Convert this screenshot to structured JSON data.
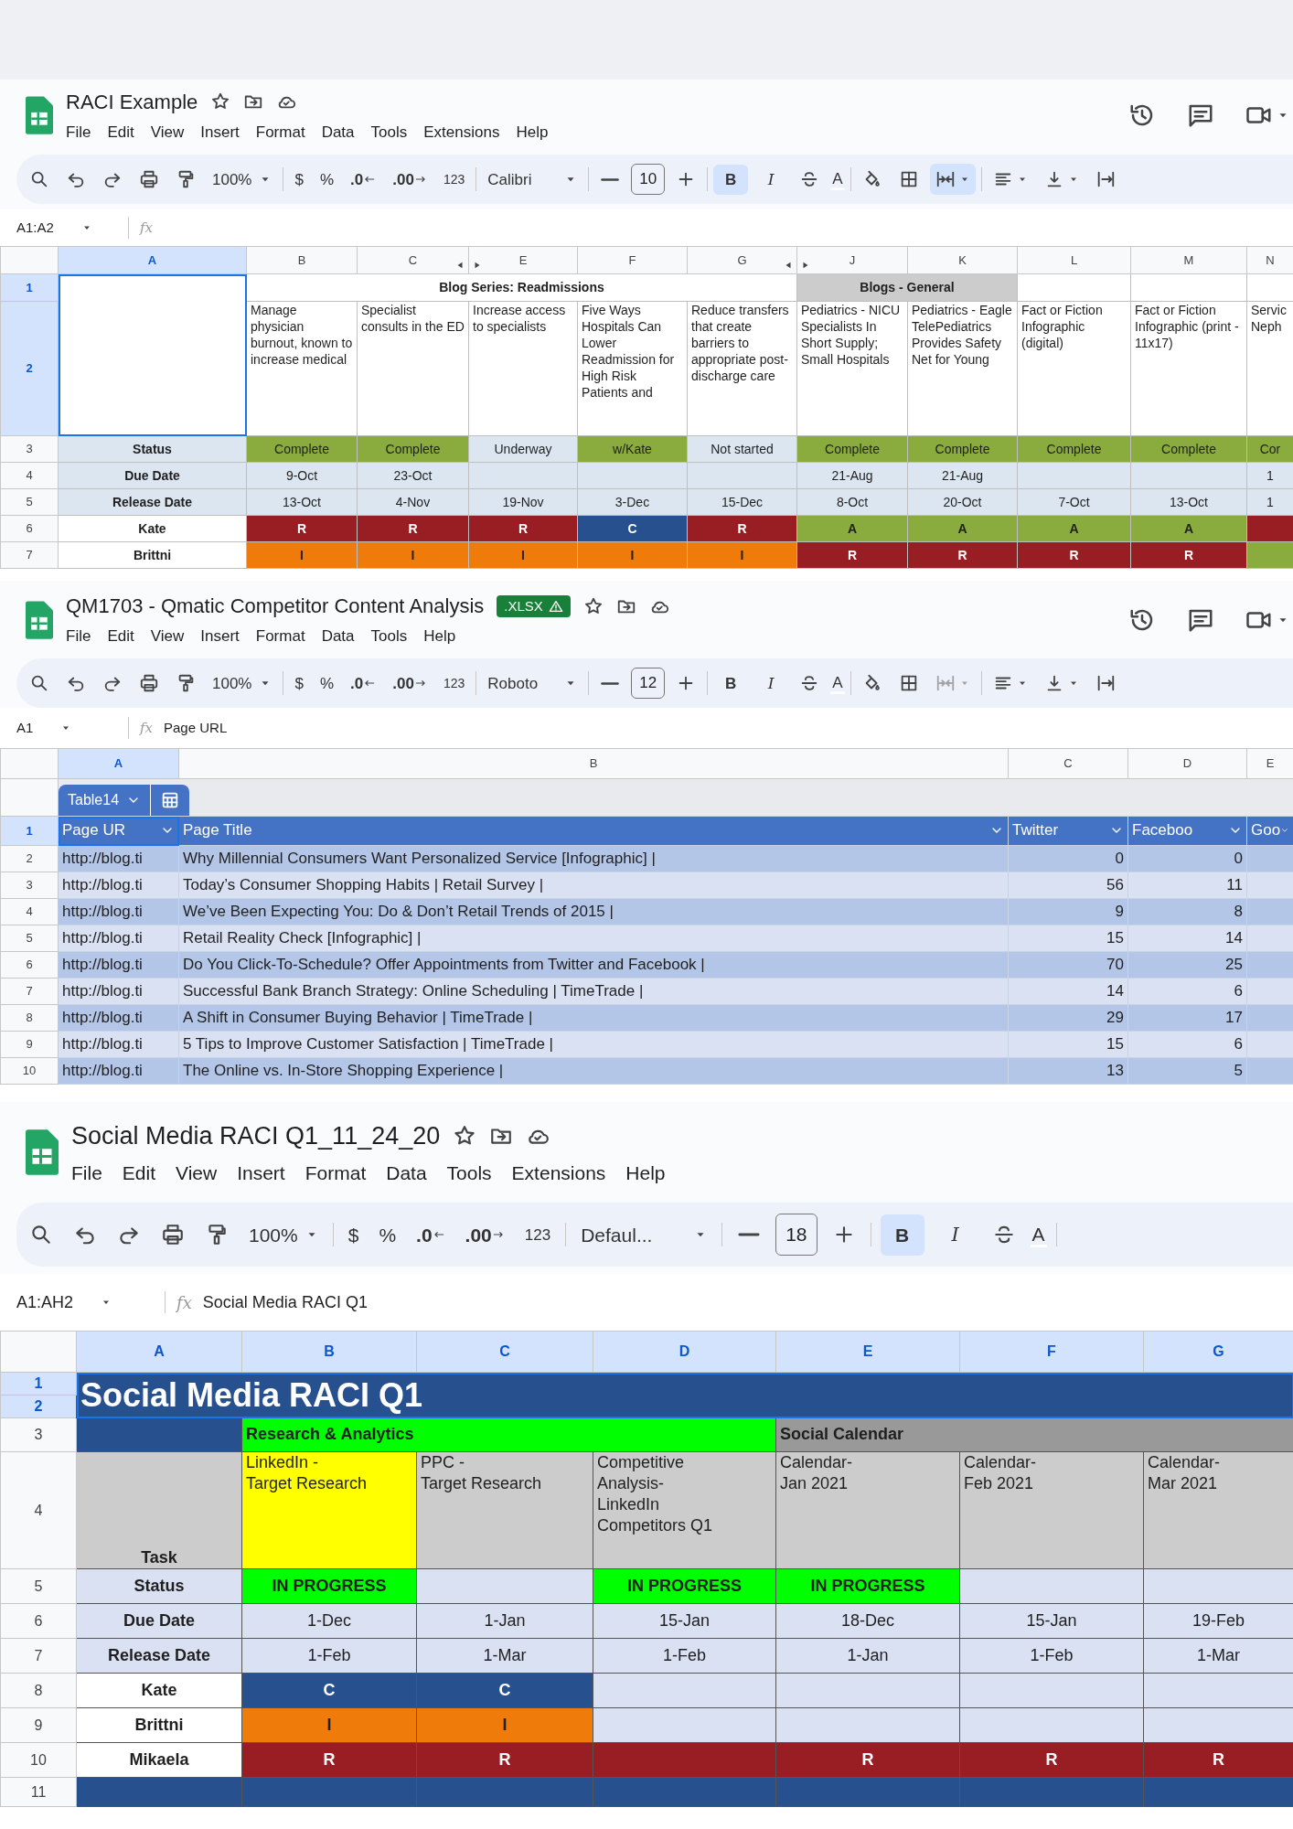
{
  "windows": [
    {
      "title": "RACI Example",
      "menu": [
        "File",
        "Edit",
        "View",
        "Insert",
        "Format",
        "Data",
        "Tools",
        "Extensions",
        "Help"
      ],
      "actions": [
        {
          "kind": "history"
        },
        {
          "kind": "comments"
        },
        {
          "kind": "video"
        }
      ],
      "toolbar": [
        {
          "kind": "search"
        },
        {
          "kind": "undo"
        },
        {
          "kind": "redo"
        },
        {
          "kind": "print"
        },
        {
          "kind": "paint_format"
        },
        {
          "kind": "zoom",
          "text": "100%"
        },
        {
          "kind": "sep"
        },
        {
          "kind": "currency",
          "text": "$"
        },
        {
          "kind": "percent",
          "text": "%"
        },
        {
          "kind": "dec_less",
          "text": ".0"
        },
        {
          "kind": "dec_more",
          "text": ".00"
        },
        {
          "kind": "number_format",
          "text": "123"
        },
        {
          "kind": "sep"
        },
        {
          "kind": "font",
          "text": "Calibri"
        },
        {
          "kind": "sep"
        },
        {
          "kind": "size_minus"
        },
        {
          "kind": "size",
          "text": "10"
        },
        {
          "kind": "size_plus"
        },
        {
          "kind": "sep"
        },
        {
          "kind": "bold",
          "text": "B",
          "on": true
        },
        {
          "kind": "italic",
          "text": "I",
          "on": false
        },
        {
          "kind": "strike"
        },
        {
          "kind": "text_color",
          "text": "A"
        },
        {
          "kind": "sep"
        },
        {
          "kind": "fill_color"
        },
        {
          "kind": "borders"
        },
        {
          "kind": "merge",
          "on": true,
          "disabled": false
        },
        {
          "kind": "sep"
        },
        {
          "kind": "align"
        },
        {
          "kind": "valign"
        },
        {
          "kind": "wrap"
        }
      ],
      "name_box": "A1:A2",
      "formula_icon": "fx",
      "columns": [
        {
          "label": "A",
          "selected": true,
          "kind": "plain"
        },
        {
          "label": "B",
          "selected": false,
          "kind": "plain"
        },
        {
          "label": "C",
          "selected": false,
          "kind": "hidden_right"
        },
        {
          "label": "E",
          "selected": false,
          "kind": "hidden_left"
        },
        {
          "label": "F",
          "selected": false,
          "kind": "plain"
        },
        {
          "label": "G",
          "selected": false,
          "kind": "hidden_right"
        },
        {
          "label": "J",
          "selected": false,
          "kind": "hidden_left"
        },
        {
          "label": "K",
          "selected": false,
          "kind": "plain"
        },
        {
          "label": "L",
          "selected": false,
          "kind": "plain"
        },
        {
          "label": "M",
          "selected": false,
          "kind": "plain"
        },
        {
          "label": "N",
          "selected": false,
          "kind": "plain"
        }
      ],
      "rows": [
        {
          "label": "1",
          "selected": true,
          "kind": "group",
          "cells": [
            {
              "rowspan": 2,
              "selected": true
            },
            {
              "colspan": 5,
              "text": "Blog Series: Readmissions"
            },
            {
              "colspan": 2,
              "text": "Blogs - General",
              "color": "#cccccc"
            },
            {
              "kind": "blank"
            },
            {
              "kind": "blank"
            },
            {
              "kind": "blank"
            }
          ]
        },
        {
          "label": "2",
          "selected": true,
          "kind": "heading",
          "cells": [
            {
              "text": "Manage physician burnout, known to increase medical"
            },
            {
              "text": "Specialist consults in the ED"
            },
            {
              "text": "Increase access to specialists"
            },
            {
              "text": "Five Ways Hospitals Can Lower Readmission for High Risk Patients and"
            },
            {
              "text": "Reduce transfers that create barriers to appropriate post-discharge care"
            },
            {
              "text": "Pediatrics - NICU Specialists In Short Supply; Small Hospitals"
            },
            {
              "text": "Pediatrics - Eagle TelePediatrics Provides Safety Net for Young"
            },
            {
              "text": "Fact or Fiction Infographic (digital)"
            },
            {
              "text": "Fact or Fiction Infographic (print - 11x17)"
            },
            {
              "text": "Servic Neph"
            }
          ]
        },
        {
          "label": "3",
          "selected": false,
          "kind": "status",
          "cells": [
            {
              "text": "Status",
              "color": "#dce6f1"
            },
            {
              "text": "Complete",
              "color": "#8aab3e"
            },
            {
              "text": "Complete",
              "color": "#8aab3e"
            },
            {
              "text": "Underway",
              "color": "#dce6f1"
            },
            {
              "text": "w/Kate",
              "color": "#8aab3e"
            },
            {
              "text": "Not started",
              "color": "#dce6f1"
            },
            {
              "text": "Complete",
              "color": "#8aab3e"
            },
            {
              "text": "Complete",
              "color": "#8aab3e"
            },
            {
              "text": "Complete",
              "color": "#8aab3e"
            },
            {
              "text": "Complete",
              "color": "#8aab3e"
            },
            {
              "text": "Cor",
              "color": "#8aab3e"
            }
          ]
        },
        {
          "label": "4",
          "selected": false,
          "kind": "date",
          "cells": [
            {
              "text": "Due Date",
              "color": "#dce6f1"
            },
            {
              "text": "9-Oct",
              "color": "#dce6f1"
            },
            {
              "text": "23-Oct",
              "color": "#dce6f1"
            },
            {
              "color": "#dce6f1"
            },
            {
              "color": "#dce6f1"
            },
            {
              "color": "#dce6f1"
            },
            {
              "text": "21-Aug",
              "color": "#dce6f1"
            },
            {
              "text": "21-Aug",
              "color": "#dce6f1"
            },
            {
              "color": "#dce6f1"
            },
            {
              "color": "#dce6f1"
            },
            {
              "text": "1",
              "color": "#dce6f1"
            }
          ]
        },
        {
          "label": "5",
          "selected": false,
          "kind": "date",
          "cells": [
            {
              "text": "Release Date",
              "color": "#dce6f1"
            },
            {
              "text": "13-Oct",
              "color": "#dce6f1"
            },
            {
              "text": "4-Nov",
              "color": "#dce6f1"
            },
            {
              "text": "19-Nov",
              "color": "#dce6f1"
            },
            {
              "text": "3-Dec",
              "color": "#dce6f1"
            },
            {
              "text": "15-Dec",
              "color": "#dce6f1"
            },
            {
              "text": "8-Oct",
              "color": "#dce6f1"
            },
            {
              "text": "20-Oct",
              "color": "#dce6f1"
            },
            {
              "text": "7-Oct",
              "color": "#dce6f1"
            },
            {
              "text": "13-Oct",
              "color": "#dce6f1"
            },
            {
              "text": "1",
              "color": "#dce6f1"
            }
          ]
        },
        {
          "label": "6",
          "selected": false,
          "kind": "raci",
          "cells": [
            {
              "text": "Kate"
            },
            {
              "text": "R",
              "color": "#981e23"
            },
            {
              "text": "R",
              "color": "#981e23"
            },
            {
              "text": "R",
              "color": "#981e23"
            },
            {
              "text": "C",
              "color": "#27508f"
            },
            {
              "text": "R",
              "color": "#981e23"
            },
            {
              "text": "A",
              "color": "#8aab3e"
            },
            {
              "text": "A",
              "color": "#8aab3e"
            },
            {
              "text": "A",
              "color": "#8aab3e"
            },
            {
              "text": "A",
              "color": "#8aab3e"
            },
            {
              "color": "#981e23"
            }
          ]
        },
        {
          "label": "7",
          "selected": false,
          "kind": "raci",
          "cells": [
            {
              "text": "Brittni"
            },
            {
              "text": "I",
              "color": "#ee7b0a"
            },
            {
              "text": "I",
              "color": "#ee7b0a"
            },
            {
              "text": "I",
              "color": "#ee7b0a"
            },
            {
              "text": "I",
              "color": "#ee7b0a"
            },
            {
              "text": "I",
              "color": "#ee7b0a"
            },
            {
              "text": "R",
              "color": "#981e23"
            },
            {
              "text": "R",
              "color": "#981e23"
            },
            {
              "text": "R",
              "color": "#981e23"
            },
            {
              "text": "R",
              "color": "#981e23"
            },
            {
              "color": "#8aab3e"
            }
          ]
        }
      ]
    },
    {
      "title": "QM1703 - Qmatic Competitor Content Analysis",
      "badge": ".XLSX",
      "menu": [
        "File",
        "Edit",
        "View",
        "Insert",
        "Format",
        "Data",
        "Tools",
        "Help"
      ],
      "actions": [
        {
          "kind": "history"
        },
        {
          "kind": "comments"
        },
        {
          "kind": "video"
        }
      ],
      "toolbar": [
        {
          "kind": "search"
        },
        {
          "kind": "undo"
        },
        {
          "kind": "redo"
        },
        {
          "kind": "print"
        },
        {
          "kind": "paint_format"
        },
        {
          "kind": "zoom",
          "text": "100%"
        },
        {
          "kind": "sep"
        },
        {
          "kind": "currency",
          "text": "$"
        },
        {
          "kind": "percent",
          "text": "%"
        },
        {
          "kind": "dec_less",
          "text": ".0"
        },
        {
          "kind": "dec_more",
          "text": ".00"
        },
        {
          "kind": "number_format",
          "text": "123"
        },
        {
          "kind": "sep"
        },
        {
          "kind": "font",
          "text": "Roboto"
        },
        {
          "kind": "sep"
        },
        {
          "kind": "size_minus"
        },
        {
          "kind": "size",
          "text": "12"
        },
        {
          "kind": "size_plus"
        },
        {
          "kind": "sep"
        },
        {
          "kind": "bold",
          "text": "B",
          "on": false
        },
        {
          "kind": "italic",
          "text": "I",
          "on": false
        },
        {
          "kind": "strike"
        },
        {
          "kind": "text_color",
          "text": "A"
        },
        {
          "kind": "sep"
        },
        {
          "kind": "fill_color"
        },
        {
          "kind": "borders"
        },
        {
          "kind": "merge",
          "on": false,
          "disabled": true
        },
        {
          "kind": "sep"
        },
        {
          "kind": "align"
        },
        {
          "kind": "valign"
        },
        {
          "kind": "wrap"
        }
      ],
      "name_box": "A1",
      "formula_icon": "fx",
      "formula": "Page URL",
      "columns": [
        {
          "label": "A",
          "selected": true,
          "kind": "plain"
        },
        {
          "label": "B",
          "selected": false,
          "kind": "plain"
        },
        {
          "label": "C",
          "selected": false,
          "kind": "plain"
        },
        {
          "label": "D",
          "selected": false,
          "kind": "plain"
        },
        {
          "label": "E",
          "selected": false,
          "kind": "plain"
        }
      ],
      "table_tab": {
        "name": "Table14"
      },
      "rows": [
        {
          "label": "1",
          "selected": true,
          "kind": "table_header",
          "color": "#4472c4",
          "cells": [
            {
              "text": "Page UR",
              "selected": true
            },
            {
              "text": "Page Title"
            },
            {
              "text": "Twitter"
            },
            {
              "text": "Faceboo"
            },
            {
              "text": "Goo"
            }
          ]
        },
        {
          "label": "2",
          "selected": false,
          "kind": "data",
          "color": "#b4c6e7",
          "cells": [
            {
              "text": "http://blog.ti"
            },
            {
              "text": "Why Millennial Consumers Want Personalized Service [Infographic] |"
            },
            {
              "kind": "number",
              "text": "0"
            },
            {
              "kind": "number",
              "text": "0"
            },
            {
              "kind": "blank"
            }
          ]
        },
        {
          "label": "3",
          "selected": false,
          "kind": "data",
          "color": "#d9e1f2",
          "cells": [
            {
              "text": "http://blog.ti"
            },
            {
              "text": "Today’s Consumer Shopping Habits | Retail Survey |"
            },
            {
              "kind": "number",
              "text": "56"
            },
            {
              "kind": "number",
              "text": "11"
            },
            {
              "kind": "blank"
            }
          ]
        },
        {
          "label": "4",
          "selected": false,
          "kind": "data",
          "color": "#b4c6e7",
          "cells": [
            {
              "text": "http://blog.ti"
            },
            {
              "text": "We’ve Been Expecting You: Do & Don’t Retail Trends of 2015 |"
            },
            {
              "kind": "number",
              "text": "9"
            },
            {
              "kind": "number",
              "text": "8"
            },
            {
              "kind": "blank"
            }
          ]
        },
        {
          "label": "5",
          "selected": false,
          "kind": "data",
          "color": "#d9e1f2",
          "cells": [
            {
              "text": "http://blog.ti"
            },
            {
              "text": "Retail Reality Check [Infographic] |"
            },
            {
              "kind": "number",
              "text": "15"
            },
            {
              "kind": "number",
              "text": "14"
            },
            {
              "kind": "blank"
            }
          ]
        },
        {
          "label": "6",
          "selected": false,
          "kind": "data",
          "color": "#b4c6e7",
          "cells": [
            {
              "text": "http://blog.ti"
            },
            {
              "text": "Do You Click-To-Schedule? Offer Appointments from Twitter and Facebook |"
            },
            {
              "kind": "number",
              "text": "70"
            },
            {
              "kind": "number",
              "text": "25"
            },
            {
              "kind": "blank"
            }
          ]
        },
        {
          "label": "7",
          "selected": false,
          "kind": "data",
          "color": "#d9e1f2",
          "cells": [
            {
              "text": "http://blog.ti"
            },
            {
              "text": "Successful Bank Branch Strategy: Online Scheduling | TimeTrade |"
            },
            {
              "kind": "number",
              "text": "14"
            },
            {
              "kind": "number",
              "text": "6"
            },
            {
              "kind": "blank"
            }
          ]
        },
        {
          "label": "8",
          "selected": false,
          "kind": "data",
          "color": "#b4c6e7",
          "cells": [
            {
              "text": "http://blog.ti"
            },
            {
              "text": "A Shift in Consumer Buying Behavior | TimeTrade |"
            },
            {
              "kind": "number",
              "text": "29"
            },
            {
              "kind": "number",
              "text": "17"
            },
            {
              "kind": "blank"
            }
          ]
        },
        {
          "label": "9",
          "selected": false,
          "kind": "data",
          "color": "#d9e1f2",
          "cells": [
            {
              "text": "http://blog.ti"
            },
            {
              "text": "5 Tips to Improve Customer Satisfaction | TimeTrade |"
            },
            {
              "kind": "number",
              "text": "15"
            },
            {
              "kind": "number",
              "text": "6"
            },
            {
              "kind": "blank"
            }
          ]
        },
        {
          "label": "10",
          "selected": false,
          "kind": "data",
          "color": "#b4c6e7",
          "cells": [
            {
              "text": "http://blog.ti"
            },
            {
              "text": "The Online vs. In-Store Shopping Experience |"
            },
            {
              "kind": "number",
              "text": "13"
            },
            {
              "kind": "number",
              "text": "5"
            },
            {
              "kind": "blank"
            }
          ]
        }
      ]
    },
    {
      "title": "Social Media RACI Q1_11_24_20",
      "menu": [
        "File",
        "Edit",
        "View",
        "Insert",
        "Format",
        "Data",
        "Tools",
        "Extensions",
        "Help"
      ],
      "toolbar": [
        {
          "kind": "search"
        },
        {
          "kind": "undo"
        },
        {
          "kind": "redo"
        },
        {
          "kind": "print"
        },
        {
          "kind": "paint_format"
        },
        {
          "kind": "zoom",
          "text": "100%"
        },
        {
          "kind": "sep"
        },
        {
          "kind": "currency",
          "text": "$"
        },
        {
          "kind": "percent",
          "text": "%"
        },
        {
          "kind": "dec_less",
          "text": ".0"
        },
        {
          "kind": "dec_more",
          "text": ".00"
        },
        {
          "kind": "number_format",
          "text": "123"
        },
        {
          "kind": "sep"
        },
        {
          "kind": "font",
          "text": "Defaul..."
        },
        {
          "kind": "sep"
        },
        {
          "kind": "size_minus"
        },
        {
          "kind": "size",
          "text": "18"
        },
        {
          "kind": "size_plus"
        },
        {
          "kind": "sep"
        },
        {
          "kind": "bold",
          "text": "B",
          "on": true
        },
        {
          "kind": "italic",
          "text": "I",
          "on": false
        },
        {
          "kind": "strike"
        },
        {
          "kind": "text_color",
          "text": "A"
        },
        {
          "kind": "sep"
        }
      ],
      "name_box": "A1:AH2",
      "formula_icon": "fx",
      "formula": "Social Media RACI Q1",
      "columns": [
        {
          "label": "A",
          "selected": true,
          "kind": "plain"
        },
        {
          "label": "B",
          "selected": true,
          "kind": "plain"
        },
        {
          "label": "C",
          "selected": true,
          "kind": "plain"
        },
        {
          "label": "D",
          "selected": true,
          "kind": "plain"
        },
        {
          "label": "E",
          "selected": true,
          "kind": "plain"
        },
        {
          "label": "F",
          "selected": true,
          "kind": "plain"
        },
        {
          "label": "G",
          "selected": true,
          "kind": "plain"
        }
      ],
      "rows": [
        {
          "label": "1",
          "selected": true,
          "kind": "title",
          "cells": [
            {
              "colspan": 7,
              "rowspan": 2,
              "text": "Social Media RACI Q1",
              "color": "#27508f",
              "selected": true
            }
          ]
        },
        {
          "label": "2",
          "selected": true,
          "kind": "title"
        },
        {
          "label": "3",
          "selected": false,
          "kind": "group",
          "cells": [
            {
              "color": "#27508f"
            },
            {
              "colspan": 3,
              "text": "Research & Analytics",
              "color": "#00ff00"
            },
            {
              "colspan": 3,
              "text": "Social Calendar",
              "color": "#999999"
            }
          ]
        },
        {
          "label": "4",
          "selected": false,
          "kind": "heading",
          "cells": [
            {
              "text": "Task",
              "color": "#cccccc"
            },
            {
              "text": "LinkedIn -\nTarget Research",
              "color": "#ffff00"
            },
            {
              "text": "PPC -\nTarget Research",
              "color": "#cccccc"
            },
            {
              "text": "Competitive\nAnalysis-\nLinkedIn\nCompetitors Q1",
              "color": "#cccccc"
            },
            {
              "text": "Calendar-\nJan 2021",
              "color": "#cccccc"
            },
            {
              "text": "Calendar-\nFeb 2021",
              "color": "#cccccc"
            },
            {
              "text": "Calendar-\nMar 2021",
              "color": "#cccccc"
            }
          ]
        },
        {
          "label": "5",
          "selected": false,
          "kind": "status",
          "cells": [
            {
              "text": "Status",
              "color": "#d9e1f2"
            },
            {
              "text": "IN PROGRESS",
              "color": "#00ff00"
            },
            {
              "color": "#d9e1f2"
            },
            {
              "text": "IN PROGRESS",
              "color": "#00ff00"
            },
            {
              "text": "IN PROGRESS",
              "color": "#00ff00"
            },
            {
              "color": "#d9e1f2"
            },
            {
              "color": "#d9e1f2"
            }
          ]
        },
        {
          "label": "6",
          "selected": false,
          "kind": "date",
          "cells": [
            {
              "text": "Due Date",
              "color": "#d9e1f2"
            },
            {
              "text": "1-Dec",
              "color": "#d9e1f2"
            },
            {
              "text": "1-Jan",
              "color": "#d9e1f2"
            },
            {
              "text": "15-Jan",
              "color": "#d9e1f2"
            },
            {
              "text": "18-Dec",
              "color": "#d9e1f2"
            },
            {
              "text": "15-Jan",
              "color": "#d9e1f2"
            },
            {
              "text": "19-Feb",
              "color": "#d9e1f2"
            }
          ]
        },
        {
          "label": "7",
          "selected": false,
          "kind": "date",
          "cells": [
            {
              "text": "Release Date",
              "color": "#d9e1f2"
            },
            {
              "text": "1-Feb",
              "color": "#d9e1f2"
            },
            {
              "text": "1-Mar",
              "color": "#d9e1f2"
            },
            {
              "text": "1-Feb",
              "color": "#d9e1f2"
            },
            {
              "text": "1-Jan",
              "color": "#d9e1f2"
            },
            {
              "text": "1-Feb",
              "color": "#d9e1f2"
            },
            {
              "text": "1-Mar",
              "color": "#d9e1f2"
            }
          ]
        },
        {
          "label": "8",
          "selected": false,
          "kind": "raci",
          "cells": [
            {
              "text": "Kate"
            },
            {
              "text": "C",
              "color": "#27508f"
            },
            {
              "text": "C",
              "color": "#27508f"
            },
            {
              "color": "#d9e1f2"
            },
            {
              "color": "#d9e1f2"
            },
            {
              "color": "#d9e1f2"
            },
            {
              "color": "#d9e1f2"
            }
          ]
        },
        {
          "label": "9",
          "selected": false,
          "kind": "raci",
          "cells": [
            {
              "text": "Brittni"
            },
            {
              "text": "I",
              "color": "#ee7b0a"
            },
            {
              "text": "I",
              "color": "#ee7b0a"
            },
            {
              "color": "#d9e1f2"
            },
            {
              "color": "#d9e1f2"
            },
            {
              "color": "#d9e1f2"
            },
            {
              "color": "#d9e1f2"
            }
          ]
        },
        {
          "label": "10",
          "selected": false,
          "kind": "raci",
          "cells": [
            {
              "text": "Mikaela"
            },
            {
              "text": "R",
              "color": "#981e23"
            },
            {
              "text": "R",
              "color": "#981e23"
            },
            {
              "color": "#981e23"
            },
            {
              "text": "R",
              "color": "#981e23"
            },
            {
              "text": "R",
              "color": "#981e23"
            },
            {
              "text": "R",
              "color": "#981e23"
            }
          ]
        },
        {
          "label": "11",
          "selected": false,
          "kind": "blank",
          "cells": [
            {
              "color": "#27508f"
            },
            {
              "color": "#27508f"
            },
            {
              "color": "#27508f"
            },
            {
              "color": "#27508f"
            },
            {
              "color": "#27508f"
            },
            {
              "color": "#27508f"
            },
            {
              "color": "#27508f"
            }
          ]
        }
      ]
    }
  ]
}
